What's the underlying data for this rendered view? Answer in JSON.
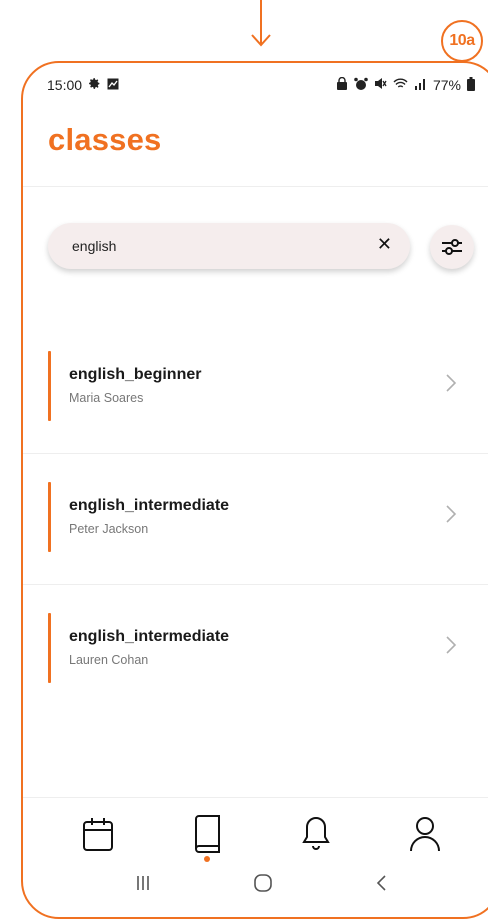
{
  "annotation": {
    "badge": "10a"
  },
  "status_bar": {
    "time": "15:00",
    "battery": "77%"
  },
  "header": {
    "title": "classes"
  },
  "search": {
    "value": "english",
    "placeholder": ""
  },
  "classes": [
    {
      "name": "english_beginner",
      "teacher": "Maria Soares"
    },
    {
      "name": "english_intermediate",
      "teacher": "Peter Jackson"
    },
    {
      "name": "english_intermediate",
      "teacher": "Lauren Cohan"
    }
  ],
  "bottom_nav": {
    "items": [
      "calendar-icon",
      "book-icon",
      "bell-icon",
      "profile-icon"
    ],
    "active": "book-icon"
  },
  "colors": {
    "accent": "#f07121",
    "search_bg": "#f5eded"
  }
}
